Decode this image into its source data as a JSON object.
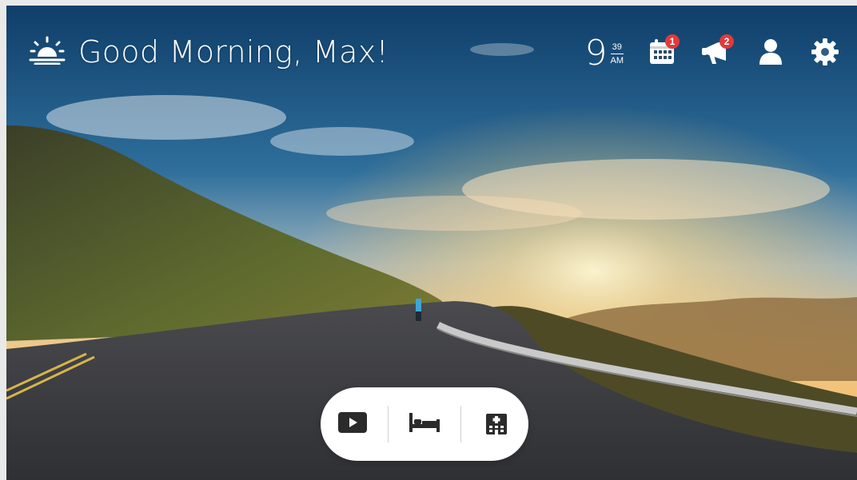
{
  "greeting": {
    "text": "Good Morning, Max!",
    "icon": "sunrise-icon"
  },
  "clock": {
    "hour": "9",
    "minute": "39",
    "ampm": "AM"
  },
  "topbar": {
    "calendar": {
      "icon": "calendar-icon",
      "badge": "1"
    },
    "notifications": {
      "icon": "megaphone-icon",
      "badge": "2"
    },
    "profile": {
      "icon": "user-icon"
    },
    "settings": {
      "icon": "gear-icon"
    }
  },
  "dock": [
    {
      "icon": "play-icon"
    },
    {
      "icon": "bed-icon"
    },
    {
      "icon": "hospital-icon"
    }
  ],
  "colors": {
    "badge": "#e23a3a",
    "dock_bg": "#ffffff",
    "icon_dark": "#2b2b2b"
  }
}
